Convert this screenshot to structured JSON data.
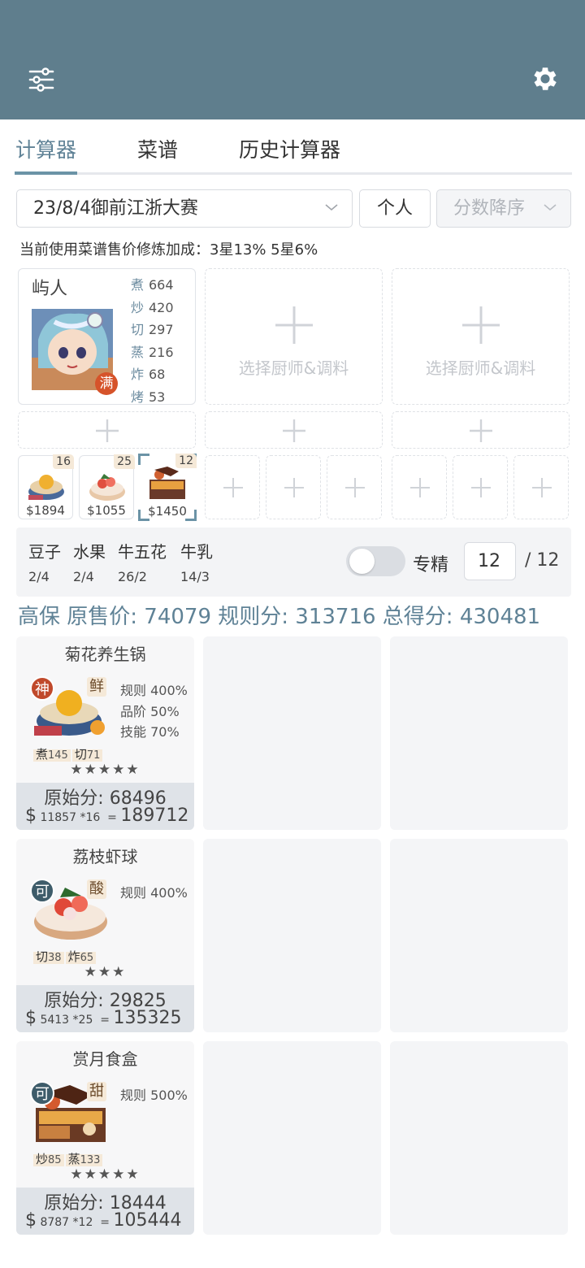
{
  "tabs": [
    "计算器",
    "菜谱",
    "历史计算器"
  ],
  "filters": {
    "contest": "23/8/4御前江浙大赛",
    "mode": "个人",
    "sort": "分数降序"
  },
  "notice": "当前使用菜谱售价修炼加成：3星13% 5星6%",
  "chef": {
    "name": "屿人",
    "badge": "满",
    "stats": [
      {
        "k": "煮",
        "v": "664"
      },
      {
        "k": "炒",
        "v": "420"
      },
      {
        "k": "切",
        "v": "297"
      },
      {
        "k": "蒸",
        "v": "216"
      },
      {
        "k": "炸",
        "v": "68"
      },
      {
        "k": "烤",
        "v": "53"
      }
    ]
  },
  "empty_chef_label": "选择厨师&调料",
  "recipe_thumbs": [
    {
      "count": "16",
      "price": "$1894"
    },
    {
      "count": "25",
      "price": "$1055"
    },
    {
      "count": "12",
      "price": "$1450"
    }
  ],
  "materials": [
    {
      "name": "豆子",
      "count": "2/4"
    },
    {
      "name": "水果",
      "count": "2/4"
    },
    {
      "name": "牛五花",
      "count": "26/2"
    },
    {
      "name": "牛乳",
      "count": "14/3"
    }
  ],
  "specialize": {
    "label": "专精",
    "value": "12",
    "total": "/ 12"
  },
  "score_line": "高保 原售价: 74079 规则分: 313716 总得分: 430481",
  "dishes": [
    {
      "title": "菊花养生锅",
      "grade": "神",
      "grade_color": "#c0492b",
      "flavor": "鲜",
      "rules": [
        "规则 400%",
        "品阶 50%",
        "技能 70%"
      ],
      "skills": [
        {
          "k": "煮",
          "v": "145"
        },
        {
          "k": "切",
          "v": "71"
        }
      ],
      "stars": "★★★★★",
      "orig": "原始分: 68496",
      "price": "11857",
      "mult": "*16",
      "total": "189712"
    },
    {
      "title": "荔枝虾球",
      "grade": "可",
      "grade_color": "#3e5c6a",
      "flavor": "酸",
      "rules": [
        "规则 400%"
      ],
      "skills": [
        {
          "k": "切",
          "v": "38"
        },
        {
          "k": "炸",
          "v": "65"
        }
      ],
      "stars": "★★★",
      "orig": "原始分: 29825",
      "price": "5413",
      "mult": "*25",
      "total": "135325"
    },
    {
      "title": "赏月食盒",
      "grade": "可",
      "grade_color": "#3e5c6a",
      "flavor": "甜",
      "rules": [
        "规则 500%"
      ],
      "skills": [
        {
          "k": "炒",
          "v": "85"
        },
        {
          "k": "蒸",
          "v": "133"
        }
      ],
      "stars": "★★★★★",
      "orig": "原始分: 18444",
      "price": "8787",
      "mult": "*12",
      "total": "105444"
    }
  ],
  "colors": {
    "header": "#5f7e8d",
    "accent": "#5f8296",
    "panel": "#f3f4f6"
  }
}
